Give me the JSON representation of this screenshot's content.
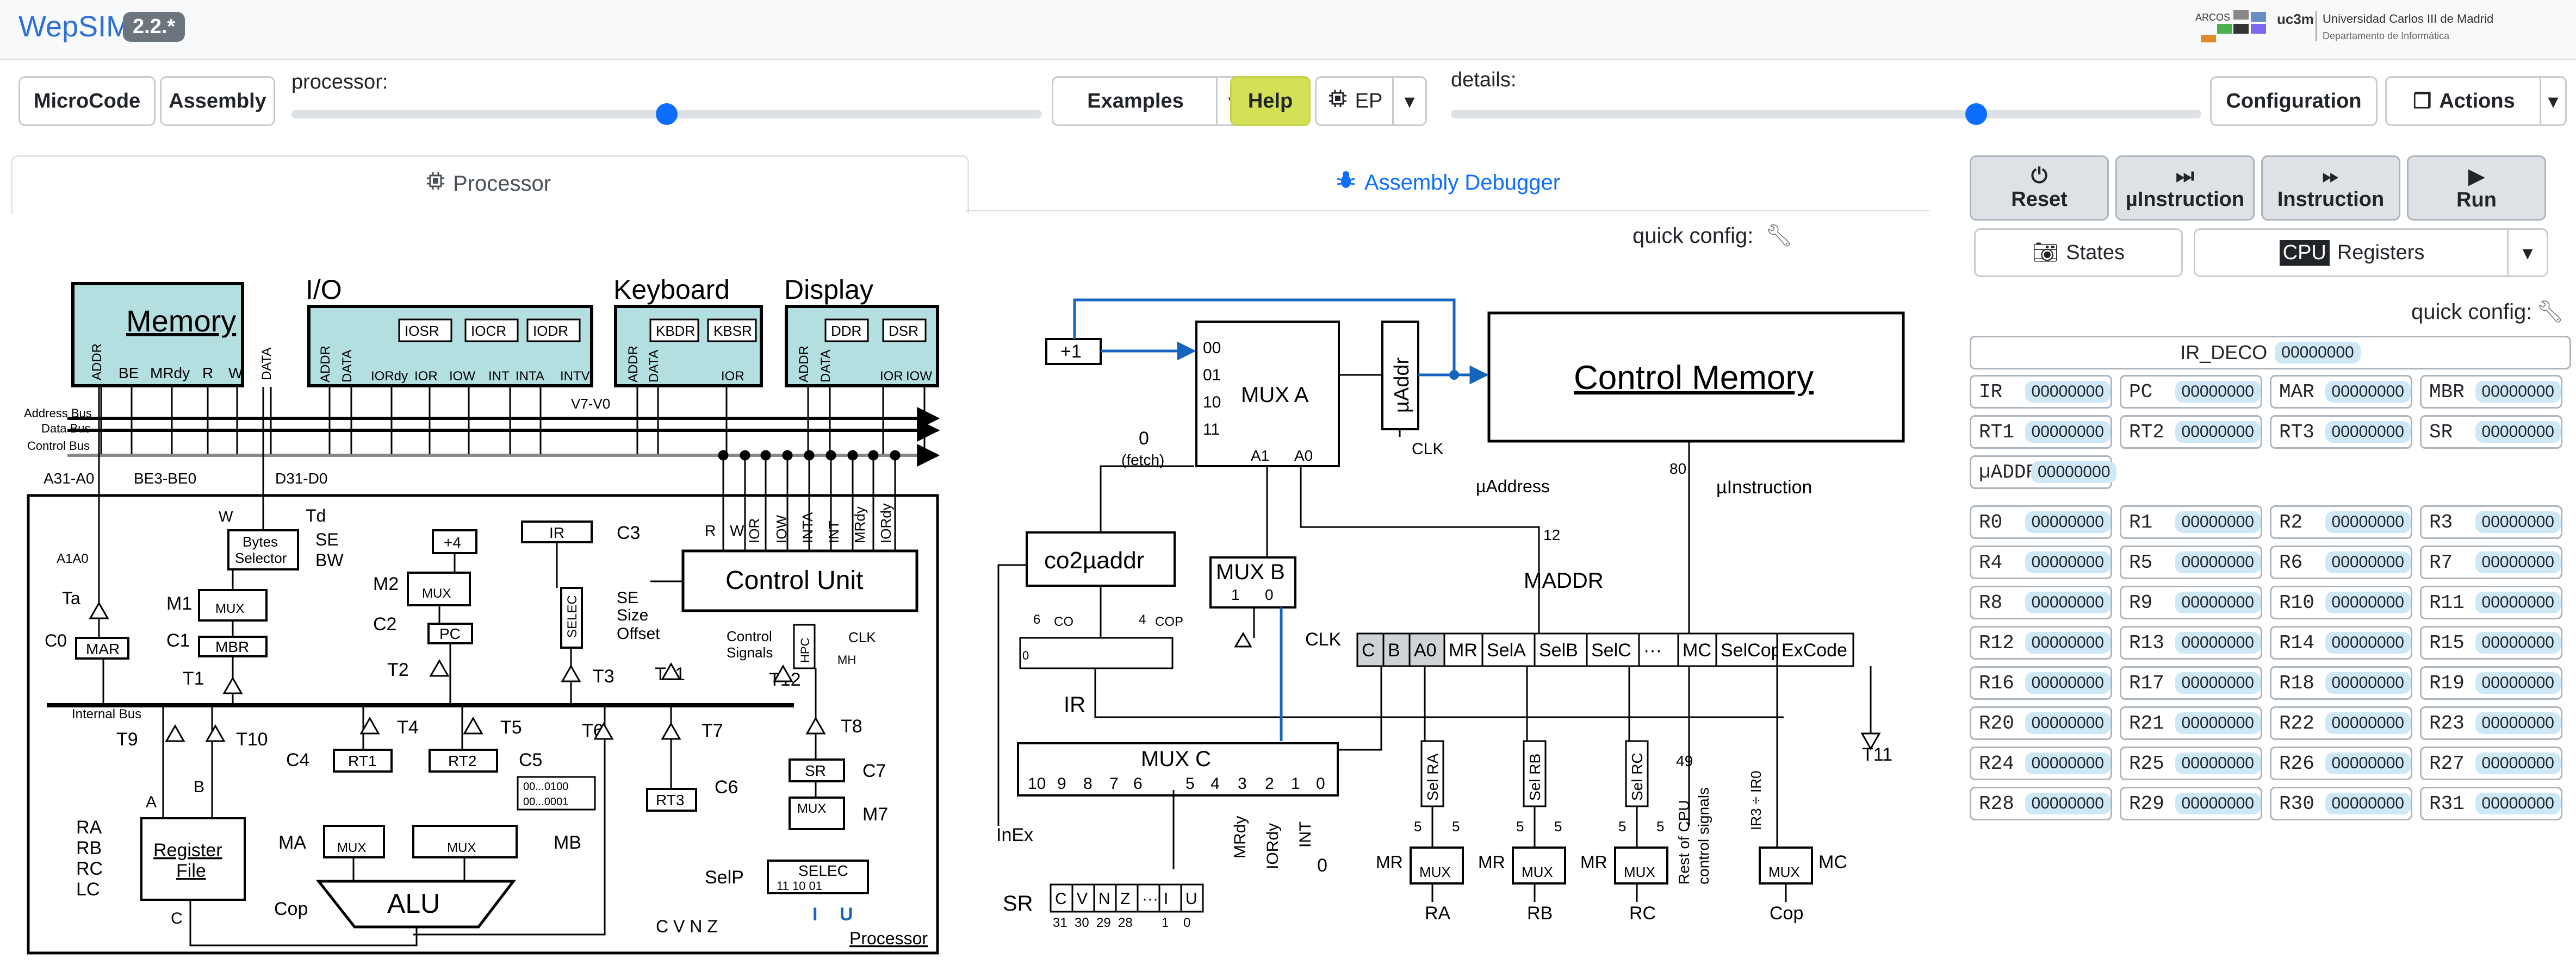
{
  "header": {
    "title": "WepSIM",
    "version": "2.2.*",
    "logo_arcos": "ARCOS",
    "logo_uc3m": "uc3m",
    "university": "Universidad Carlos III de Madrid",
    "department": "Departamento de Informática"
  },
  "toolbar": {
    "microcode": "MicroCode",
    "assembly": "Assembly",
    "processor_label": "processor:",
    "processor_slider": 0.5,
    "examples": "Examples",
    "help": "Help",
    "mode": "EP",
    "details_label": "details:",
    "details_slider": 0.7,
    "configuration": "Configuration",
    "actions": "Actions"
  },
  "tabs": {
    "processor": "Processor",
    "debugger": "Assembly Debugger",
    "quick_config": "quick config:"
  },
  "controls": {
    "reset": "Reset",
    "uinstruction": "µInstruction",
    "instruction": "Instruction",
    "run": "Run",
    "states": "States",
    "cpu_tag": "CPU",
    "registers": "Registers",
    "quick_config": "quick config:"
  },
  "registers": {
    "ir_deco": {
      "name": "IR_DECO",
      "value": "00000000"
    },
    "special": [
      {
        "name": "IR",
        "value": "00000000"
      },
      {
        "name": "PC",
        "value": "00000000"
      },
      {
        "name": "MAR",
        "value": "00000000"
      },
      {
        "name": "MBR",
        "value": "00000000"
      },
      {
        "name": "RT1",
        "value": "00000000"
      },
      {
        "name": "RT2",
        "value": "00000000"
      },
      {
        "name": "RT3",
        "value": "00000000"
      },
      {
        "name": "SR",
        "value": "00000000"
      },
      {
        "name": "µADDR",
        "value": "00000000"
      }
    ],
    "general": [
      {
        "name": "R0",
        "value": "00000000"
      },
      {
        "name": "R1",
        "value": "00000000"
      },
      {
        "name": "R2",
        "value": "00000000"
      },
      {
        "name": "R3",
        "value": "00000000"
      },
      {
        "name": "R4",
        "value": "00000000"
      },
      {
        "name": "R5",
        "value": "00000000"
      },
      {
        "name": "R6",
        "value": "00000000"
      },
      {
        "name": "R7",
        "value": "00000000"
      },
      {
        "name": "R8",
        "value": "00000000"
      },
      {
        "name": "R9",
        "value": "00000000"
      },
      {
        "name": "R10",
        "value": "00000000"
      },
      {
        "name": "R11",
        "value": "00000000"
      },
      {
        "name": "R12",
        "value": "00000000"
      },
      {
        "name": "R13",
        "value": "00000000"
      },
      {
        "name": "R14",
        "value": "00000000"
      },
      {
        "name": "R15",
        "value": "00000000"
      },
      {
        "name": "R16",
        "value": "00000000"
      },
      {
        "name": "R17",
        "value": "00000000"
      },
      {
        "name": "R18",
        "value": "00000000"
      },
      {
        "name": "R19",
        "value": "00000000"
      },
      {
        "name": "R20",
        "value": "00000000"
      },
      {
        "name": "R21",
        "value": "00000000"
      },
      {
        "name": "R22",
        "value": "00000000"
      },
      {
        "name": "R23",
        "value": "00000000"
      },
      {
        "name": "R24",
        "value": "00000000"
      },
      {
        "name": "R25",
        "value": "00000000"
      },
      {
        "name": "R26",
        "value": "00000000"
      },
      {
        "name": "R27",
        "value": "00000000"
      },
      {
        "name": "R28",
        "value": "00000000"
      },
      {
        "name": "R29",
        "value": "00000000"
      },
      {
        "name": "R30",
        "value": "00000000"
      },
      {
        "name": "R31",
        "value": "00000000"
      }
    ]
  },
  "cpu": {
    "memory": "Memory",
    "io": "I/O",
    "keyboard": "Keyboard",
    "display": "Display",
    "mem_pins": [
      "ADDR",
      "BE",
      "MRdy",
      "R",
      "W",
      "DATA"
    ],
    "io_pins": [
      "ADDR",
      "DATA",
      "IORdy",
      "IOR",
      "IOW",
      "INT",
      "INTA",
      "INTV"
    ],
    "io_regs": [
      "IOSR",
      "IOCR",
      "IODR"
    ],
    "kb_regs": [
      "KBDR",
      "KBSR"
    ],
    "kb_pins": [
      "ADDR",
      "DATA",
      "IOR"
    ],
    "disp_regs": [
      "DDR",
      "DSR"
    ],
    "disp_pins": [
      "ADDR",
      "DATA",
      "IOR",
      "IOW"
    ],
    "bus_address": "Address Bus",
    "bus_data": "Data Bus",
    "bus_control": "Control Bus",
    "internal_bus": "Internal Bus",
    "control_unit": "Control Unit",
    "register_file": "Register File",
    "alu": "ALU",
    "bytes_selector": "Bytes Selector",
    "labels": {
      "a31a0": "A31-A0",
      "be3be0": "BE3-BE0",
      "d31d0": "D31-D0",
      "a1a0": "A1A0",
      "td": "Td",
      "se": "SE",
      "bw": "BW",
      "ta": "Ta",
      "c0": "C0",
      "mar": "MAR",
      "m1": "M1",
      "mux": "MUX",
      "c1": "C1",
      "mbr": "MBR",
      "t1": "T1",
      "plus4": "+4",
      "m2": "M2",
      "c2": "C2",
      "pc": "PC",
      "t2": "T2",
      "ir": "IR",
      "c3": "C3",
      "selec": "SELEC",
      "size": "Size",
      "offset": "Offset",
      "t3": "T3",
      "control_signals": "Control Signals",
      "clk": "CLK",
      "mh": "MH",
      "hpc": "HPC",
      "t11": "T11",
      "t12": "T12",
      "t8": "T8",
      "t9": "T9",
      "t10": "T10",
      "t4": "T4",
      "t5": "T5",
      "t6": "T6",
      "t7": "T7",
      "c4": "C4",
      "rt1": "RT1",
      "rt2": "RT2",
      "c5": "C5",
      "rt3": "RT3",
      "c6": "C6",
      "sr": "SR",
      "c7": "C7",
      "m7": "M7",
      "ma": "MA",
      "mb": "MB",
      "k100": "00...0100",
      "k001": "00...0001",
      "cop": "Cop",
      "selp": "SelP",
      "cvnz": "C V N Z",
      "i": "I",
      "u": "U",
      "processor": "Processor",
      "ra": "RA",
      "rb": "RB",
      "rc": "RC",
      "lc": "LC",
      "a": "A",
      "b": "B",
      "c": "C",
      "r": "R",
      "w": "W",
      "ior": "IOR",
      "iow": "IOW",
      "inta": "INTA",
      "int": "INT",
      "mrdy": "MRdy",
      "iordy": "IORdy",
      "v7v0": "V7-V0"
    }
  },
  "cu": {
    "control_memory": "Control Memory",
    "mux_a": "MUX A",
    "uaddr": "µAddr",
    "mux_b": "MUX B",
    "co2uaddr": "co2µaddr",
    "mux_c": "MUX C",
    "maddr": "MADDR",
    "plus1": "+1",
    "fetch": "(fetch)",
    "uaddress": "µAddress",
    "uinstruction": "µInstruction",
    "ir": "IR",
    "inex": "InEx",
    "sr": "SR",
    "clk": "CLK",
    "mux_a_inputs": [
      "00",
      "01",
      "10",
      "11"
    ],
    "fields": [
      "C",
      "B",
      "A0",
      "MR",
      "SelA",
      "SelB",
      "SelC",
      "···",
      "MC",
      "SelCop",
      "ExCode"
    ],
    "sr_bits": [
      "C",
      "V",
      "N",
      "Z",
      "···",
      "I",
      "U"
    ],
    "sr_idx": [
      "31",
      "30",
      "29",
      "28",
      "",
      "1",
      "0"
    ],
    "mux_c_inputs": [
      "10",
      "9",
      "8",
      "7",
      "6",
      "5",
      "4",
      "3",
      "2",
      "1",
      "0"
    ],
    "sel_labels": [
      "Sel RA",
      "Sel RB",
      "Sel RC"
    ],
    "out_labels": [
      "RA",
      "RB",
      "RC",
      "Cop"
    ],
    "mr": "MR",
    "mc": "MC",
    "co": "CO",
    "cop": "COP",
    "rest": "Rest of CPU control signals",
    "ir3ir0": "IR3 ÷ IR0",
    "mrdy": "MRdy",
    "iordy": "IORdy",
    "int": "INT",
    "bits": {
      "b80": "80",
      "b12": "12",
      "b6": "6",
      "b4": "4",
      "b49": "49",
      "b5": "5",
      "b0": "0",
      "b1": "1"
    }
  }
}
